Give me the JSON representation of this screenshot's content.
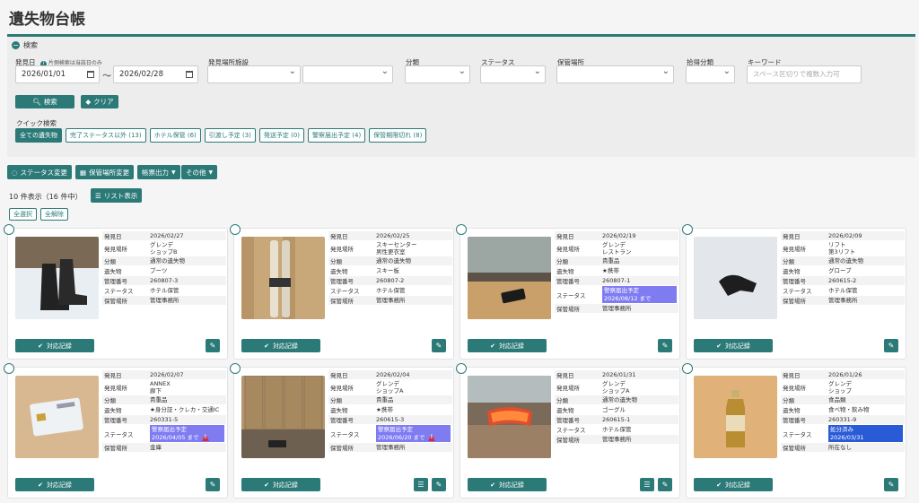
{
  "page": {
    "title": "遺失物台帳"
  },
  "search": {
    "header": "検索",
    "date_label": "発見日",
    "date_note": "片側検索は当該日のみ",
    "date_from": "2026/01/01",
    "date_sep": "〜",
    "date_to": "2026/02/28",
    "place_label": "発見場所施設",
    "category_label": "分類",
    "status_label": "ステータス",
    "storage_label": "保管場所",
    "pickup_label": "拾得分類",
    "keyword_label": "キーワード",
    "keyword_placeholder": "スペース区切りで複数入力可",
    "search_button": "検索",
    "clear_button": "クリア"
  },
  "quick": {
    "label": "クイック検索",
    "chips": [
      "全ての遺失物",
      "完了ステータス以外 (13)",
      "ホテル保管 (6)",
      "引渡し予定 (3)",
      "発送予定 (0)",
      "警察届出予定 (4)",
      "保管期限切れ (8)"
    ]
  },
  "actions": {
    "status_change": "ステータス変更",
    "storage_change": "保管場所変更",
    "form_output": "帳票出力",
    "other": "その他"
  },
  "list": {
    "count": "10 件表示（16 件中）",
    "list_view": "リスト表示",
    "select_all": "全選択",
    "deselect_all": "全解除"
  },
  "labels": {
    "date": "発見日",
    "place": "発見場所",
    "category": "分類",
    "item": "遺失物",
    "number": "管理番号",
    "status": "ステータス",
    "storage": "保管場所"
  },
  "record_button": "対応記録",
  "colors": {
    "primary": "#2b7a78",
    "police": "#7f7cf2",
    "done": "#2a5bd7",
    "warn": "#d82c3c"
  },
  "cards": [
    {
      "date": "2026/02/27",
      "place1": "グレンデ",
      "place2": "ショップB",
      "category": "通常の遺失物",
      "item": "ブーツ",
      "number": "260807-3",
      "status1": "ホテル保管",
      "status2": "",
      "status_kind": "plain",
      "storage": "管理事務所",
      "image": "boots-photo"
    },
    {
      "date": "2026/02/25",
      "place1": "スキーセンター",
      "place2": "男性更衣室",
      "category": "通常の遺失物",
      "item": "スキー板",
      "number": "260807-2",
      "status1": "ホテル保管",
      "status2": "",
      "status_kind": "plain",
      "storage": "管理事務所",
      "image": "skis-photo"
    },
    {
      "date": "2026/02/19",
      "place1": "グレンデ",
      "place2": "レストラン",
      "category": "貴重品",
      "item": "★携帯",
      "number": "260807-1",
      "status1": "警察届出予定",
      "status2": "2026/08/12 まで",
      "status_kind": "police",
      "storage": "管理事務所",
      "image": "phone-photo"
    },
    {
      "date": "2026/02/09",
      "place1": "リフト",
      "place2": "第3リフト",
      "category": "通常の遺失物",
      "item": "グローブ",
      "number": "260615-2",
      "status1": "ホテル保管",
      "status2": "",
      "status_kind": "plain",
      "storage": "管理事務所",
      "image": "glove-photo"
    },
    {
      "date": "2026/02/07",
      "place1": "ANNEX",
      "place2": "廊下",
      "category": "貴重品",
      "item": "★身分証・クレカ・交通IC",
      "number": "260331-5",
      "status1": "警察届出予定",
      "status2": "2026/04/05 まで",
      "status_kind": "police-warn",
      "storage": "金庫",
      "image": "card-photo"
    },
    {
      "date": "2026/02/04",
      "place1": "グレンデ",
      "place2": "ショップA",
      "category": "貴重品",
      "item": "★携帯",
      "number": "260615-3",
      "status1": "警察届出予定",
      "status2": "2026/06/20 まで",
      "status_kind": "police-warn",
      "storage": "管理事務所",
      "image": "locker-photo"
    },
    {
      "date": "2026/01/31",
      "place1": "グレンデ",
      "place2": "ショップA",
      "category": "通常の遺失物",
      "item": "ゴーグル",
      "number": "260615-1",
      "status1": "ホテル保管",
      "status2": "",
      "status_kind": "plain",
      "storage": "管理事務所",
      "image": "goggles-photo"
    },
    {
      "date": "2026/01/26",
      "place1": "グレンデ",
      "place2": "ショップ",
      "category": "食品類",
      "item": "食べ物・飲み物",
      "number": "260331-9",
      "status1": "処分済み",
      "status2": "2026/03/31",
      "status_kind": "done",
      "storage": "所在なし",
      "image": "bottle-photo"
    }
  ]
}
